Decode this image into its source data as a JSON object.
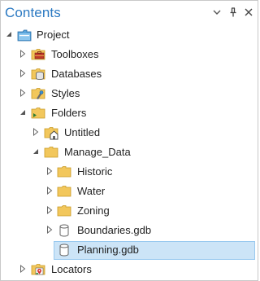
{
  "panel": {
    "title": "Contents",
    "buttons": [
      "chevron-down-icon",
      "pin-icon",
      "close-icon"
    ],
    "accent_color": "#2b79c2",
    "selection_color": "#cce4f7"
  },
  "tree": {
    "project": {
      "label": "Project",
      "state": "expanded"
    },
    "toolboxes": {
      "label": "Toolboxes",
      "state": "collapsed"
    },
    "databases": {
      "label": "Databases",
      "state": "collapsed"
    },
    "styles": {
      "label": "Styles",
      "state": "collapsed"
    },
    "folders": {
      "label": "Folders",
      "state": "expanded"
    },
    "untitled": {
      "label": "Untitled",
      "state": "collapsed"
    },
    "manage_data": {
      "label": "Manage_Data",
      "state": "expanded"
    },
    "historic": {
      "label": "Historic",
      "state": "collapsed"
    },
    "water": {
      "label": "Water",
      "state": "collapsed"
    },
    "zoning": {
      "label": "Zoning",
      "state": "collapsed"
    },
    "boundaries": {
      "label": "Boundaries.gdb",
      "state": "collapsed"
    },
    "planning": {
      "label": "Planning.gdb",
      "state": "selected"
    },
    "locators": {
      "label": "Locators",
      "state": "collapsed"
    }
  }
}
